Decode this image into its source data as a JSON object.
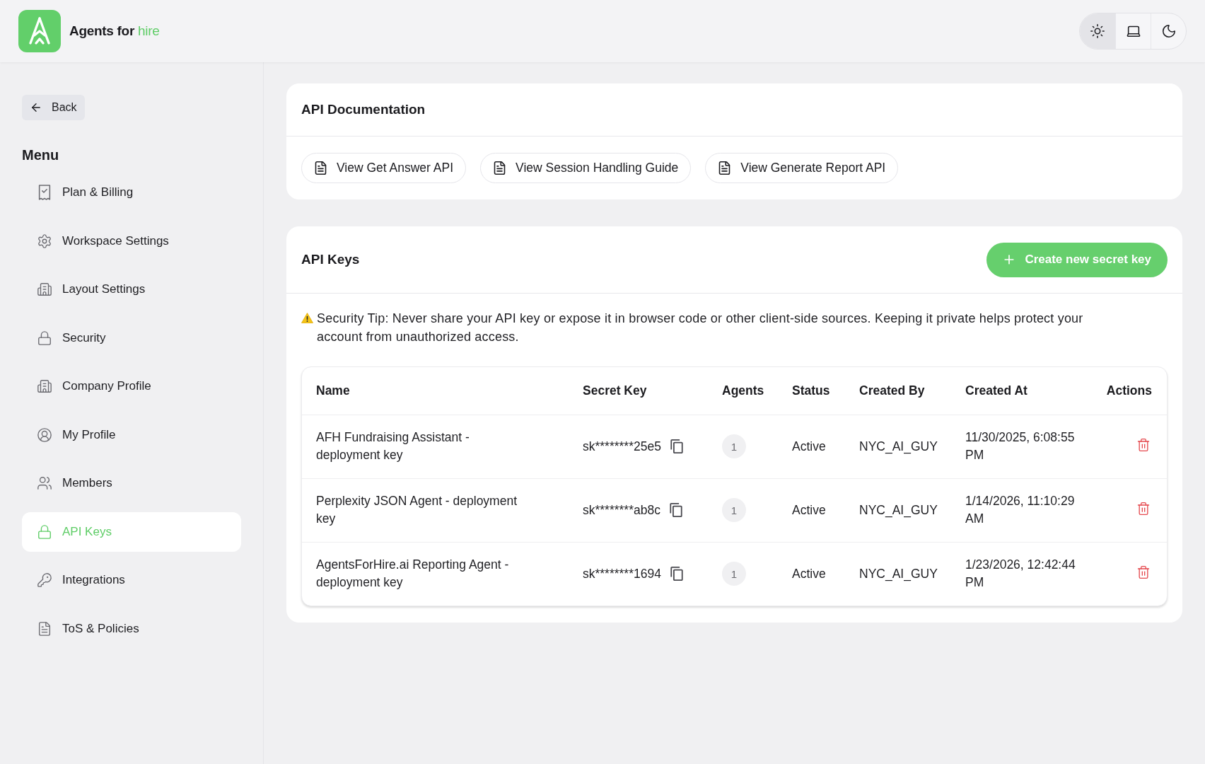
{
  "header": {
    "brand": {
      "name": "Agents for",
      "highlight": "hire"
    },
    "theme_options": [
      {
        "kind": "light",
        "selected": true
      },
      {
        "kind": "system",
        "selected": false
      },
      {
        "kind": "dark",
        "selected": false
      }
    ]
  },
  "sidebar": {
    "back_button": "Back",
    "menu_title": "Menu",
    "items": [
      {
        "label": "Plan & Billing",
        "selected": false
      },
      {
        "label": "Workspace Settings",
        "selected": false
      },
      {
        "label": "Layout Settings",
        "selected": false
      },
      {
        "label": "Security",
        "selected": false
      },
      {
        "label": "Company Profile",
        "selected": false
      },
      {
        "label": "My Profile",
        "selected": false
      },
      {
        "label": "Members",
        "selected": false
      },
      {
        "label": "API Keys",
        "selected": true
      },
      {
        "label": "Integrations",
        "selected": false
      },
      {
        "label": "ToS & Policies",
        "selected": false
      }
    ]
  },
  "api_documentation": {
    "title": "API Documentation",
    "links": [
      "View Get Answer API",
      "View Session Handling Guide",
      "View Generate Report API"
    ]
  },
  "api_keys": {
    "title": "API Keys",
    "create_button": "Create new secret key",
    "security_tip": "Security Tip: Never share your API key or expose it in browser code or other client-side sources. Keeping it private helps protect your account from unauthorized access.",
    "table": {
      "columns": [
        "Name",
        "Secret Key",
        "Agents",
        "Status",
        "Created By",
        "Created At",
        "Actions"
      ],
      "rows": [
        {
          "name": "AFH Fundraising Assistant - deployment key",
          "secret_key": "sk********25e5",
          "agents": "1",
          "status": "Active",
          "created_by": "NYC_AI_GUY",
          "created_at": "11/30/2025, 6:08:55 PM"
        },
        {
          "name": "Perplexity JSON Agent - deployment key",
          "secret_key": "sk********ab8c",
          "agents": "1",
          "status": "Active",
          "created_by": "NYC_AI_GUY",
          "created_at": "1/14/2026, 11:10:29 AM"
        },
        {
          "name": "AgentsForHire.ai Reporting Agent - deployment key",
          "secret_key": "sk********1694",
          "agents": "1",
          "status": "Active",
          "created_by": "NYC_AI_GUY",
          "created_at": "1/23/2026, 12:42:44 PM"
        }
      ]
    }
  }
}
